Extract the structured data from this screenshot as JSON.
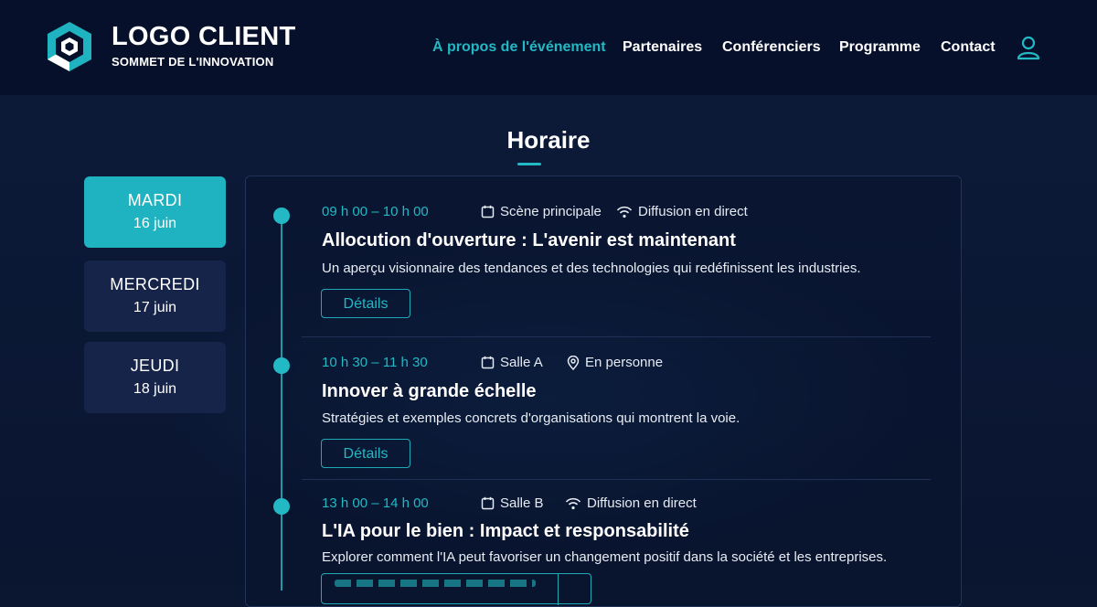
{
  "brand": {
    "title": "LOGO CLIENT",
    "subtitle": "SOMMET DE L'INNOVATION"
  },
  "nav": {
    "items": [
      {
        "label": "À propos de l'événement",
        "active": true
      },
      {
        "label": "Partenaires",
        "active": false
      },
      {
        "label": "Conférenciers",
        "active": false
      },
      {
        "label": "Programme",
        "active": false
      },
      {
        "label": "Contact",
        "active": false
      }
    ],
    "user_icon": "user-icon"
  },
  "page": {
    "title": "Horaire"
  },
  "days": [
    {
      "name": "MARDI",
      "date": "16 juin",
      "active": true
    },
    {
      "name": "MERCREDI",
      "date": "17 juin",
      "active": false
    },
    {
      "name": "JEUDI",
      "date": "18 juin",
      "active": false
    }
  ],
  "events": [
    {
      "time": "09 h 00 – 10 h 00",
      "location": "Scène principale",
      "location_icon": "calendar-icon",
      "format": "Diffusion en direct",
      "format_icon": "broadcast-icon",
      "title": "Allocution d'ouverture : L'avenir est maintenant",
      "description": "Un aperçu visionnaire des tendances et des technologies qui redéfinissent les industries.",
      "button": "Détails"
    },
    {
      "time": "10 h 30 – 11 h 30",
      "location": "Salle A",
      "location_icon": "calendar-icon",
      "format": "En personne",
      "format_icon": "map-pin-icon",
      "title": "Innover à grande échelle",
      "description": "Stratégies et exemples concrets d'organisations qui montrent la voie.",
      "button": "Détails"
    },
    {
      "time": "13 h 00 – 14 h 00",
      "location": "Salle B",
      "location_icon": "calendar-icon",
      "format": "Diffusion en direct",
      "format_icon": "broadcast-icon",
      "title": "L'IA pour le bien : Impact et responsabilité",
      "description": "Explorer comment l'IA peut favoriser un changement positif dans la société et les entreprises."
    }
  ],
  "colors": {
    "background": "#0b1631",
    "header": "#07102a",
    "accent": "#22b8c4",
    "tab_inactive": "#17244a"
  }
}
